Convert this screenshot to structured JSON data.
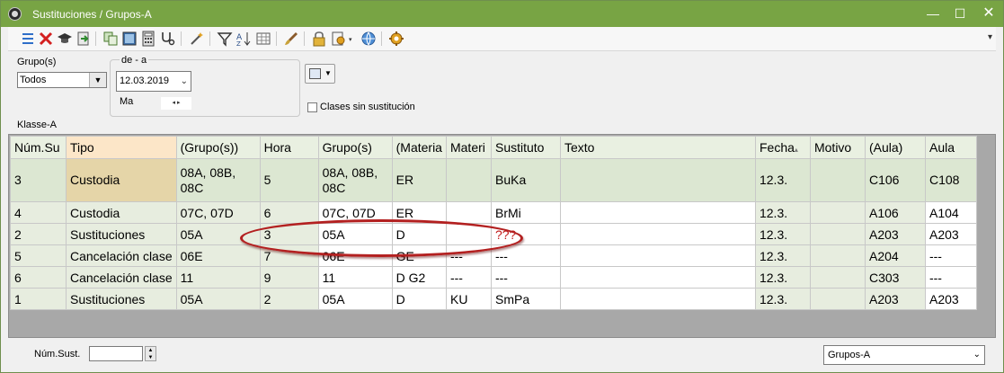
{
  "window": {
    "title": "Sustituciones / Grupos-A",
    "controls": {
      "minimize": "—",
      "maximize": "☐",
      "close": "✕"
    },
    "accent_color": "#78a444"
  },
  "toolbar": {
    "icons": [
      "list-icon",
      "delete-icon",
      "graduation-cap-icon",
      "export-icon",
      "copy-icon",
      "picture-icon",
      "calculator-icon",
      "stethoscope-icon",
      "magic-wand-icon",
      "filter-icon",
      "sort-icon",
      "grid-icon",
      "brush-icon",
      "lock-icon",
      "settings-dropdown-icon",
      "globe-icon",
      "gear-icon"
    ],
    "overflow": "▾"
  },
  "filters": {
    "group_label": "Grupo(s)",
    "group_value": "Todos",
    "range_label": "de - a",
    "date_value": "12.03.2019",
    "day_label": "Ma",
    "nav_arrows": "◂ ▸",
    "class_label": "Klasse-A",
    "unsubstituted_label": "Clases sin sustitución",
    "unsubstituted_checked": false
  },
  "table": {
    "columns": [
      "Núm.Su",
      "Tipo",
      "(Grupo(s))",
      "Hora",
      "Grupo(s)",
      "(Materia",
      "Materi",
      "Sustituto",
      "Texto",
      "Fecha",
      "Motivo",
      "(Aula)",
      "Aula"
    ],
    "sort_indicator": "▴",
    "rows": [
      [
        "3",
        "Custodia",
        "08A, 08B, 08C",
        "5",
        "08A, 08B, 08C",
        "ER",
        "",
        "BuKa",
        "",
        "12.3.",
        "",
        "C106",
        "C108"
      ],
      [
        "4",
        "Custodia",
        "07C, 07D",
        "6",
        "07C, 07D",
        "ER",
        "",
        "BrMi",
        "",
        "12.3.",
        "",
        "A106",
        "A104"
      ],
      [
        "2",
        "Sustituciones",
        "05A",
        "3",
        "05A",
        "D",
        "",
        "???",
        "",
        "12.3.",
        "",
        "A203",
        "A203"
      ],
      [
        "5",
        "Cancelación clase",
        "06E",
        "7",
        "06E",
        "GE",
        "---",
        "---",
        "",
        "12.3.",
        "",
        "A204",
        "---"
      ],
      [
        "6",
        "Cancelación clase",
        "11",
        "9",
        "11",
        "D  G2",
        "---",
        "---",
        "",
        "12.3.",
        "",
        "C303",
        "---"
      ],
      [
        "1",
        "Sustituciones",
        "05A",
        "2",
        "05A",
        "D",
        "KU",
        "SmPa",
        "",
        "12.3.",
        "",
        "A203",
        "A203"
      ]
    ],
    "selected_row": 0,
    "highlighted_row": 2
  },
  "bottom": {
    "count_label": "Núm.Sust.",
    "count_value": "",
    "group_select": "Grupos-A"
  }
}
